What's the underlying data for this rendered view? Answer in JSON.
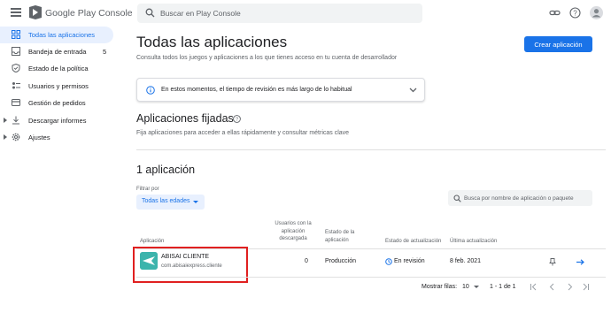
{
  "header": {
    "brand_google": "Google Play",
    "brand_console": "Console",
    "search_placeholder": "Buscar en Play Console"
  },
  "sidebar": {
    "items": [
      {
        "label": "Todas las aplicaciones",
        "active": true,
        "icon": "grid-icon"
      },
      {
        "label": "Bandeja de entrada",
        "badge": "5",
        "icon": "inbox-icon"
      },
      {
        "label": "Estado de la política",
        "icon": "shield-icon"
      },
      {
        "label": "Usuarios y permisos",
        "icon": "users-icon"
      },
      {
        "label": "Gestión de pedidos",
        "icon": "credit-card-icon"
      },
      {
        "label": "Descargar informes",
        "icon": "download-icon",
        "expandable": true
      },
      {
        "label": "Ajustes",
        "icon": "gear-icon",
        "expandable": true
      }
    ]
  },
  "main": {
    "title": "Todas las aplicaciones",
    "subtitle": "Consulta todos los juegos y aplicaciones a los que tienes acceso en tu cuenta de desarrollador",
    "create_button": "Crear aplicación",
    "banner": "En estos momentos, el tiempo de revisión es más largo de lo habitual",
    "pinned_title": "Aplicaciones fijadas",
    "pinned_desc": "Fija aplicaciones para acceder a ellas rápidamente y consultar métricas clave",
    "count_title": "1 aplicación",
    "filter_label": "Filtrar por",
    "filter_value": "Todas las edades",
    "app_search_placeholder": "Busca por nombre de aplicación o paquete"
  },
  "table": {
    "headers": {
      "app": "Aplicación",
      "installs_1": "Usuarios con la",
      "installs_2": "aplicación",
      "installs_3": "descargada",
      "status_1": "Estado de la",
      "status_2": "aplicación",
      "update_status": "Estado de actualización",
      "last_update": "Última actualización"
    },
    "rows": [
      {
        "name": "ABISAI CLIENTE",
        "package": "com.abisaiexpress.cliente",
        "installs": "0",
        "app_status": "Producción",
        "update_status": "En revisión",
        "last_update": "8 feb. 2021"
      }
    ]
  },
  "pagination": {
    "rows_label": "Mostrar filas:",
    "rows_value": "10",
    "range": "1 - 1 de 1"
  },
  "colors": {
    "accent": "#1a73e8",
    "highlight": "#e02020",
    "app_icon": "#3cb4ac"
  }
}
